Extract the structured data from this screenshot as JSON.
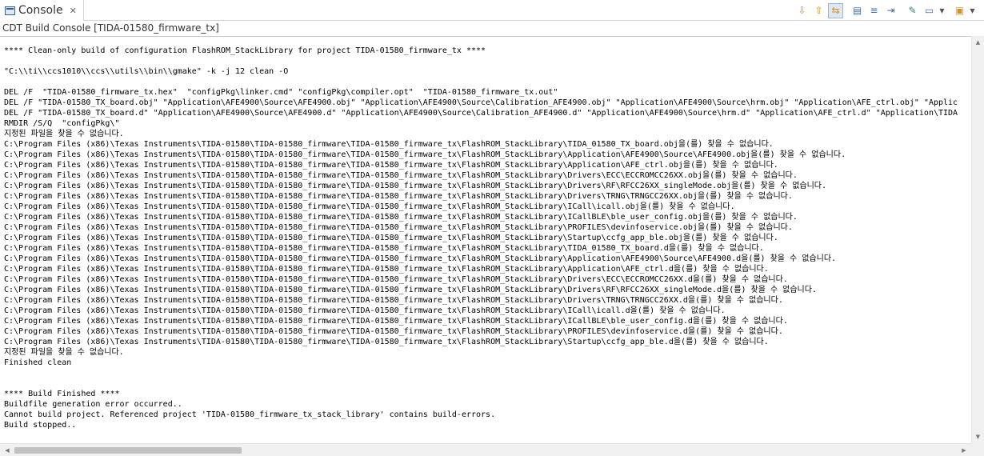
{
  "tab": {
    "title": "Console",
    "close_icon": "close-icon",
    "icon": "console-icon"
  },
  "toolbar": {
    "icons": [
      "next-error-icon",
      "previous-error-icon",
      "link-with-editor-icon",
      "clear-console-icon",
      "scroll-lock-icon",
      "word-wrap-icon",
      "pin-console-icon",
      "display-selected-console-icon",
      "open-console-icon"
    ],
    "glyphs": {
      "next_error": "⇩",
      "previous_error": "⇧",
      "link_with_editor": "⇆",
      "clear_console": "▤",
      "scroll_lock": "≡",
      "word_wrap": "⇥",
      "pin_console": "✎",
      "display_selected": "▭",
      "open_console": "▣",
      "dropdown": "▼"
    }
  },
  "console": {
    "name": "CDT Build Console [TIDA-01580_firmware_tx]",
    "lines": [
      "**** Clean-only build of configuration FlashROM_StackLibrary for project TIDA-01580_firmware_tx ****",
      "",
      "\"C:\\\\ti\\\\ccs1010\\\\ccs\\\\utils\\\\bin\\\\gmake\" -k -j 12 clean -O",
      "",
      "DEL /F  \"TIDA-01580_firmware_tx.hex\"  \"configPkg\\linker.cmd\" \"configPkg\\compiler.opt\"  \"TIDA-01580_firmware_tx.out\"",
      "DEL /F \"TIDA-01580_TX_board.obj\" \"Application\\AFE4900\\Source\\AFE4900.obj\" \"Application\\AFE4900\\Source\\Calibration_AFE4900.obj\" \"Application\\AFE4900\\Source\\hrm.obj\" \"Application\\AFE_ctrl.obj\" \"Applic",
      "DEL /F \"TIDA-01580_TX_board.d\" \"Application\\AFE4900\\Source\\AFE4900.d\" \"Application\\AFE4900\\Source\\Calibration_AFE4900.d\" \"Application\\AFE4900\\Source\\hrm.d\" \"Application\\AFE_ctrl.d\" \"Application\\TIDA",
      "RMDIR /S/Q  \"configPkg\\\"",
      "지정된 파일을 찾을 수 없습니다.",
      "C:\\Program Files (x86)\\Texas Instruments\\TIDA-01580\\TIDA-01580_firmware\\TIDA-01580_firmware_tx\\FlashROM_StackLibrary\\TIDA_01580_TX_board.obj을(를) 찾을 수 없습니다.",
      "C:\\Program Files (x86)\\Texas Instruments\\TIDA-01580\\TIDA-01580_firmware\\TIDA-01580_firmware_tx\\FlashROM_StackLibrary\\Application\\AFE4900\\Source\\AFE4900.obj을(를) 찾을 수 없습니다.",
      "C:\\Program Files (x86)\\Texas Instruments\\TIDA-01580\\TIDA-01580_firmware\\TIDA-01580_firmware_tx\\FlashROM_StackLibrary\\Application\\AFE_ctrl.obj을(를) 찾을 수 없습니다.",
      "C:\\Program Files (x86)\\Texas Instruments\\TIDA-01580\\TIDA-01580_firmware\\TIDA-01580_firmware_tx\\FlashROM_StackLibrary\\Drivers\\ECC\\ECCROMCC26XX.obj을(를) 찾을 수 없습니다.",
      "C:\\Program Files (x86)\\Texas Instruments\\TIDA-01580\\TIDA-01580_firmware\\TIDA-01580_firmware_tx\\FlashROM_StackLibrary\\Drivers\\RF\\RFCC26XX_singleMode.obj을(를) 찾을 수 없습니다.",
      "C:\\Program Files (x86)\\Texas Instruments\\TIDA-01580\\TIDA-01580_firmware\\TIDA-01580_firmware_tx\\FlashROM_StackLibrary\\Drivers\\TRNG\\TRNGCC26XX.obj을(를) 찾을 수 없습니다.",
      "C:\\Program Files (x86)\\Texas Instruments\\TIDA-01580\\TIDA-01580_firmware\\TIDA-01580_firmware_tx\\FlashROM_StackLibrary\\ICall\\icall.obj을(를) 찾을 수 없습니다.",
      "C:\\Program Files (x86)\\Texas Instruments\\TIDA-01580\\TIDA-01580_firmware\\TIDA-01580_firmware_tx\\FlashROM_StackLibrary\\ICallBLE\\ble_user_config.obj을(를) 찾을 수 없습니다.",
      "C:\\Program Files (x86)\\Texas Instruments\\TIDA-01580\\TIDA-01580_firmware\\TIDA-01580_firmware_tx\\FlashROM_StackLibrary\\PROFILES\\devinfoservice.obj을(를) 찾을 수 없습니다.",
      "C:\\Program Files (x86)\\Texas Instruments\\TIDA-01580\\TIDA-01580_firmware\\TIDA-01580_firmware_tx\\FlashROM_StackLibrary\\Startup\\ccfg_app_ble.obj을(를) 찾을 수 없습니다.",
      "C:\\Program Files (x86)\\Texas Instruments\\TIDA-01580\\TIDA-01580_firmware\\TIDA-01580_firmware_tx\\FlashROM_StackLibrary\\TIDA_01580_TX_board.d을(를) 찾을 수 없습니다.",
      "C:\\Program Files (x86)\\Texas Instruments\\TIDA-01580\\TIDA-01580_firmware\\TIDA-01580_firmware_tx\\FlashROM_StackLibrary\\Application\\AFE4900\\Source\\AFE4900.d을(를) 찾을 수 없습니다.",
      "C:\\Program Files (x86)\\Texas Instruments\\TIDA-01580\\TIDA-01580_firmware\\TIDA-01580_firmware_tx\\FlashROM_StackLibrary\\Application\\AFE_ctrl.d을(를) 찾을 수 없습니다.",
      "C:\\Program Files (x86)\\Texas Instruments\\TIDA-01580\\TIDA-01580_firmware\\TIDA-01580_firmware_tx\\FlashROM_StackLibrary\\Drivers\\ECC\\ECCROMCC26XX.d을(를) 찾을 수 없습니다.",
      "C:\\Program Files (x86)\\Texas Instruments\\TIDA-01580\\TIDA-01580_firmware\\TIDA-01580_firmware_tx\\FlashROM_StackLibrary\\Drivers\\RF\\RFCC26XX_singleMode.d을(를) 찾을 수 없습니다.",
      "C:\\Program Files (x86)\\Texas Instruments\\TIDA-01580\\TIDA-01580_firmware\\TIDA-01580_firmware_tx\\FlashROM_StackLibrary\\Drivers\\TRNG\\TRNGCC26XX.d을(를) 찾을 수 없습니다.",
      "C:\\Program Files (x86)\\Texas Instruments\\TIDA-01580\\TIDA-01580_firmware\\TIDA-01580_firmware_tx\\FlashROM_StackLibrary\\ICall\\icall.d을(를) 찾을 수 없습니다.",
      "C:\\Program Files (x86)\\Texas Instruments\\TIDA-01580\\TIDA-01580_firmware\\TIDA-01580_firmware_tx\\FlashROM_StackLibrary\\ICallBLE\\ble_user_config.d을(를) 찾을 수 없습니다.",
      "C:\\Program Files (x86)\\Texas Instruments\\TIDA-01580\\TIDA-01580_firmware\\TIDA-01580_firmware_tx\\FlashROM_StackLibrary\\PROFILES\\devinfoservice.d을(를) 찾을 수 없습니다.",
      "C:\\Program Files (x86)\\Texas Instruments\\TIDA-01580\\TIDA-01580_firmware\\TIDA-01580_firmware_tx\\FlashROM_StackLibrary\\Startup\\ccfg_app_ble.d을(를) 찾을 수 없습니다.",
      "지정된 파일을 찾을 수 없습니다.",
      "Finished clean",
      "",
      "",
      "**** Build Finished ****",
      "Buildfile generation error occurred..",
      "Cannot build project. Referenced project 'TIDA-01580_firmware_tx_stack_library' contains build-errors.",
      "Build stopped.."
    ]
  },
  "scrollbars": {
    "horizontal_position": 0.0,
    "vertical_position": 0.0
  }
}
